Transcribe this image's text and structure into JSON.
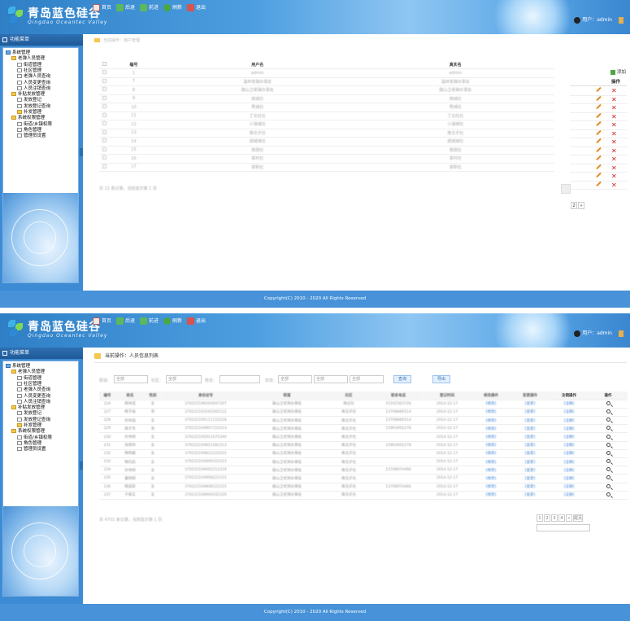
{
  "app": {
    "title": "青岛蓝色硅谷",
    "subtitle": "Qingdao Oceantec Valley",
    "user_label": "用户：admin",
    "footer": "Copyright(C) 2010 - 2020 All Rights Reserved"
  },
  "toolbar": [
    {
      "label": "首页",
      "icon": "home-icon",
      "color": "#d9d9d9"
    },
    {
      "label": "后退",
      "icon": "back-arrow-icon",
      "color": "#5cb85c"
    },
    {
      "label": "前进",
      "icon": "forward-arrow-icon",
      "color": "#5cb85c"
    },
    {
      "label": "刷新",
      "icon": "refresh-icon",
      "color": "#4aa843"
    },
    {
      "label": "退出",
      "icon": "exit-icon",
      "color": "#d9534f"
    }
  ],
  "sidebar": {
    "header": "功能菜单",
    "tree": [
      {
        "label": "系统管理",
        "type": "comp",
        "level": 0
      },
      {
        "label": "老弹人员管理",
        "type": "folder",
        "level": 1
      },
      {
        "label": "街道管理",
        "type": "doc",
        "level": 2
      },
      {
        "label": "社区管理",
        "type": "doc",
        "level": 2
      },
      {
        "label": "老弹人员查询",
        "type": "doc",
        "level": 2
      },
      {
        "label": "人员变更查询",
        "type": "doc",
        "level": 2
      },
      {
        "label": "人员注销查询",
        "type": "doc",
        "level": 2
      },
      {
        "label": "补贴发放管理",
        "type": "folder",
        "level": 1
      },
      {
        "label": "发放登记",
        "type": "doc",
        "level": 2
      },
      {
        "label": "发放登记查询",
        "type": "doc",
        "level": 2
      },
      {
        "label": "补发管理",
        "type": "folder",
        "level": 2
      },
      {
        "label": "系统权限管理",
        "type": "folder",
        "level": 1
      },
      {
        "label": "街道/乡镇权限",
        "type": "doc",
        "level": 2
      },
      {
        "label": "角色管理",
        "type": "doc",
        "level": 2
      },
      {
        "label": "管理员设置",
        "type": "doc",
        "level": 2
      }
    ]
  },
  "page1": {
    "crumb": "当前操作：用户管理",
    "columns": [
      "编号",
      "用户名",
      "真实名"
    ],
    "rows": [
      [
        "1",
        "admin",
        "admin"
      ],
      [
        "7",
        "温林老弹办事处",
        "温林老弹办事处"
      ],
      [
        "8",
        "融山卫老弹办事处",
        "融山卫老弹办事处"
      ],
      [
        "9",
        "西城社",
        "西城社"
      ],
      [
        "10",
        "秀城社",
        "秀城社"
      ],
      [
        "11",
        "丁北社社",
        "丁北社社"
      ],
      [
        "12",
        "小海城社",
        "小海城社"
      ],
      [
        "13",
        "南北乎社",
        "南北乎社"
      ],
      [
        "14",
        "胡城城社",
        "胡城城社"
      ],
      [
        "15",
        "南保社",
        "南保社"
      ],
      [
        "16",
        "章村社",
        "章村社"
      ],
      [
        "17",
        "章职社",
        "章职社"
      ]
    ],
    "ops_header": "操作",
    "add_label": "添加",
    "summary": "共 12 条记录，当前显示第 1 页",
    "pager": [
      "2",
      "»"
    ]
  },
  "page2": {
    "crumb": "当前操作：人员信息列表",
    "filters": {
      "labels": [
        "街道：",
        "社区：",
        "姓名：",
        "状态："
      ],
      "values": [
        "全部",
        "全部",
        "",
        "全部",
        "全部",
        "全部"
      ],
      "query_btn": "查询",
      "export_btn": "导出"
    },
    "columns": [
      "编号",
      "姓名",
      "性别",
      "身份证号",
      "街道",
      "社区",
      "联系电话",
      "登记时间",
      "修改操作",
      "变更操作",
      "注销操作",
      "操作"
    ],
    "rows": [
      [
        "224",
        "韩伟成",
        "女",
        "370222196503047307",
        "融山卫老弹办事处",
        "南庄社",
        "15162563726",
        "2014-12-17",
        "[修改]",
        "[变更]",
        "[注销]"
      ],
      [
        "227",
        "韩子威",
        "男",
        "370222193103302122",
        "融山卫老弹办事处",
        "南北乎社",
        "13708666514",
        "2014-12-17",
        "[修改]",
        "[变更]",
        "[注销]"
      ],
      [
        "228",
        "孙伟强",
        "女",
        "370222195111153318",
        "融山卫老弹办事处",
        "南北乎社",
        "13708666514",
        "2014-12-17",
        "[修改]",
        "[变更]",
        "[注销]"
      ],
      [
        "229",
        "韩子杰",
        "男",
        "370222194807153313",
        "融山卫老弹办事处",
        "南北乎社",
        "15963002278",
        "2014-12-17",
        "[修改]",
        "[变更]",
        "[注销]"
      ],
      [
        "230",
        "孙伟明",
        "女",
        "370222195911072340",
        "融山卫老弹办事处",
        "南北乎社",
        "",
        "2014-12-17",
        "[修改]",
        "[变更]",
        "[注销]"
      ],
      [
        "231",
        "张德伟",
        "女",
        "370222194811282313",
        "融山卫老弹办事处",
        "南北乎社",
        "15963002278",
        "2014-12-17",
        "[修改]",
        "[变更]",
        "[注销]"
      ],
      [
        "232",
        "韩明媚",
        "女",
        "370222194812222315",
        "融山卫老弹办事处",
        "南北乎社",
        "",
        "2014-12-17",
        "[修改]",
        "[变更]",
        "[注销]"
      ],
      [
        "233",
        "韩向前",
        "女",
        "370222193909322323",
        "融山卫老弹办事处",
        "南北乎社",
        "",
        "2014-12-17",
        "[修改]",
        "[变更]",
        "[注销]"
      ],
      [
        "234",
        "孙伟明",
        "女",
        "370222194002212319",
        "融山卫老弹办事处",
        "南北乎社",
        "13708974466",
        "2014-12-17",
        "[修改]",
        "[变更]",
        "[注销]"
      ],
      [
        "235",
        "董明明",
        "女",
        "370222193908222315",
        "融山卫老弹办事处",
        "南北乎社",
        "",
        "2014-12-17",
        "[修改]",
        "[变更]",
        "[注销]"
      ],
      [
        "236",
        "韩成新",
        "女",
        "370222194808122315",
        "融山卫老弹办事处",
        "南北乎社",
        "13708974466",
        "2014-12-17",
        "[修改]",
        "[变更]",
        "[注销]"
      ],
      [
        "237",
        "于春军",
        "女",
        "370222194909192320",
        "融山卫老弹办事处",
        "南北乎社",
        "",
        "2014-12-17",
        "[修改]",
        "[变更]",
        "[注销]"
      ]
    ],
    "summary": "共 4701 条记录，当前显示第 1 页",
    "pager": [
      "1",
      "2",
      "3",
      "4",
      "»",
      "尾页"
    ]
  }
}
